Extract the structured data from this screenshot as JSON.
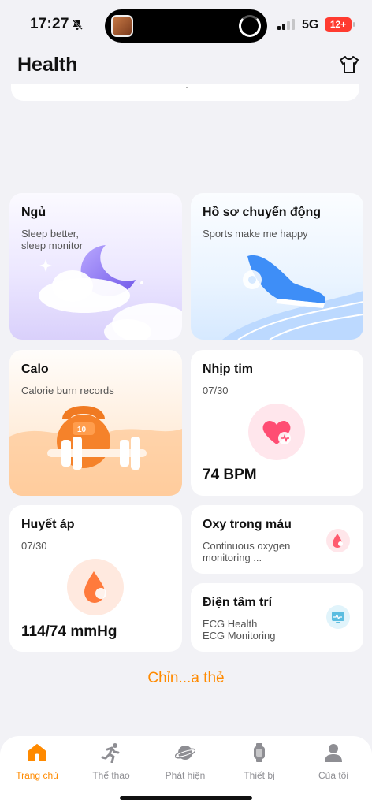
{
  "status_bar": {
    "time": "17:27",
    "network": "5G",
    "battery": "12+"
  },
  "header": {
    "title": "Health"
  },
  "cards": {
    "sleep": {
      "title": "Ngủ",
      "subtitle": "Sleep better,\nsleep monitor"
    },
    "sport": {
      "title": "Hồ sơ chuyển động",
      "subtitle": "Sports make me happy"
    },
    "calo": {
      "title": "Calo",
      "subtitle": "Calorie burn records",
      "plate_number": "10"
    },
    "heart": {
      "title": "Nhịp tim",
      "date": "07/30",
      "value": "74 BPM"
    },
    "blood_pressure": {
      "title": "Huyết áp",
      "date": "07/30",
      "value": "114/74 mmHg"
    },
    "oxygen": {
      "title": "Oxy trong máu",
      "subtitle": "Continuous oxygen\nmonitoring ..."
    },
    "ecg": {
      "title": "Điện tâm trí",
      "subtitle": "ECG Health\nECG Monitoring"
    }
  },
  "edit_cards_label": "Chỉn...a thẻ",
  "bottom_nav": {
    "items": [
      {
        "label": "Trang chủ",
        "icon": "home-icon",
        "active": true
      },
      {
        "label": "Thể thao",
        "icon": "running-icon",
        "active": false
      },
      {
        "label": "Phát hiện",
        "icon": "planet-icon",
        "active": false
      },
      {
        "label": "Thiết bị",
        "icon": "watch-icon",
        "active": false
      },
      {
        "label": "Của tôi",
        "icon": "person-icon",
        "active": false
      }
    ]
  },
  "colors": {
    "accent": "#ff8a00",
    "background": "#f2f2f6",
    "card": "#ffffff"
  }
}
